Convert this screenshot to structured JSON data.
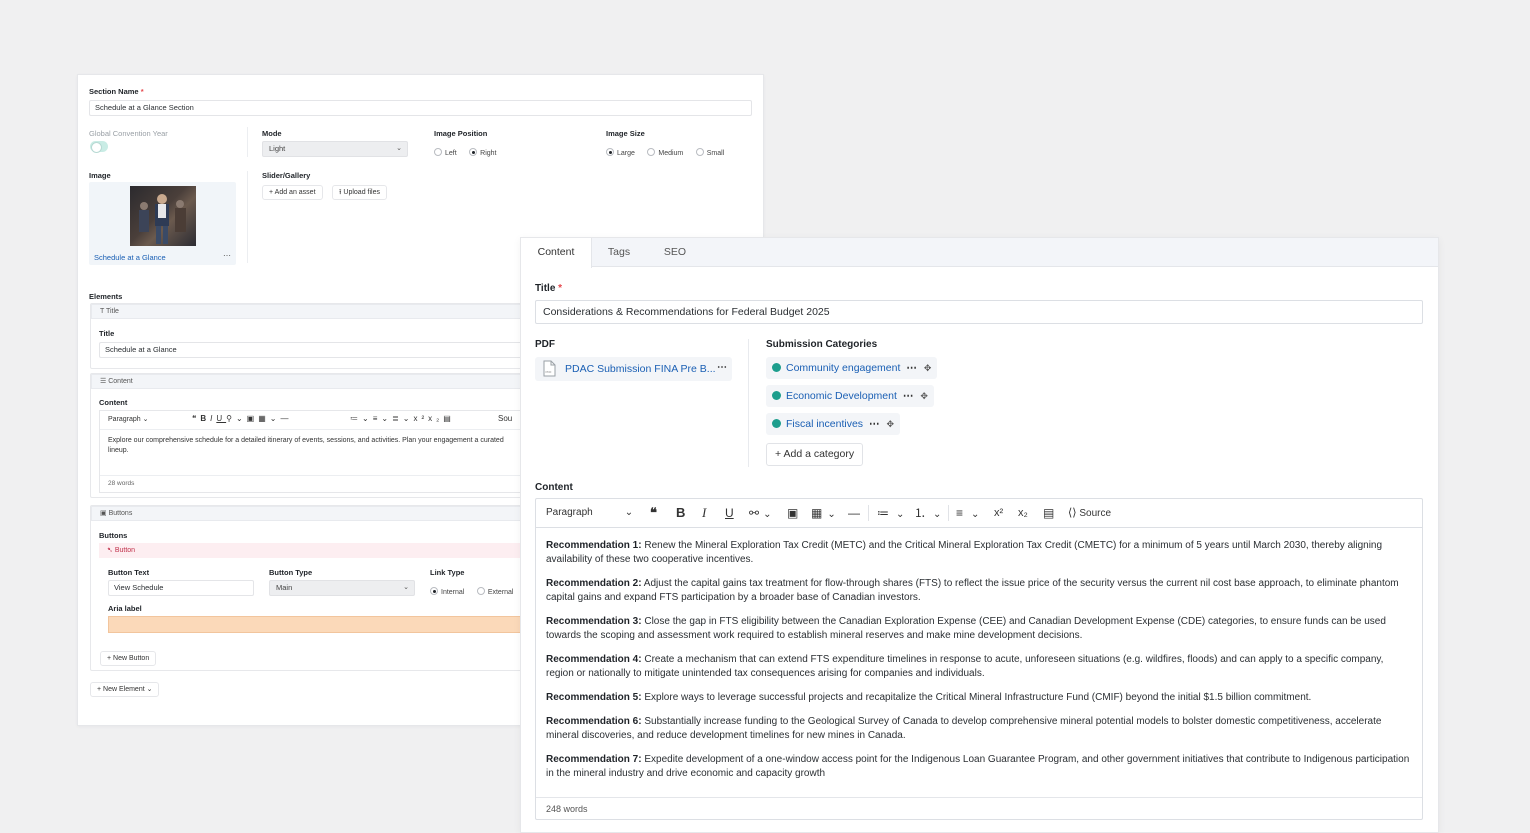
{
  "back": {
    "section_name_label": "Section Name",
    "required_mark": "*",
    "section_name_value": "Schedule at a Glance Section",
    "global_year_label": "Global Convention Year",
    "mode_label": "Mode",
    "mode_value": "Light",
    "image_position_label": "Image Position",
    "image_position_options": [
      "Left",
      "Right"
    ],
    "image_position_selected": "Right",
    "image_size_label": "Image Size",
    "image_size_options": [
      "Large",
      "Medium",
      "Small"
    ],
    "image_size_selected": "Large",
    "image_label": "Image",
    "image_caption": "Schedule at a Glance",
    "image_more": "⋯",
    "slider_label": "Slider/Gallery",
    "add_asset": "+ Add an asset",
    "upload_files": "Upload files",
    "elements_label": "Elements",
    "title_block_label": "Title",
    "title_field_label": "Title",
    "title_value": "Schedule at a Glance",
    "content_block_label": "Content",
    "content_field_label": "Content",
    "toolbar_paragraph": "Paragraph",
    "toolbar_source": "Sou",
    "content_text": "Explore our comprehensive schedule for a detailed itinerary of events, sessions, and activities. Plan your engagement a curated lineup.",
    "content_words": "28 words",
    "buttons_block_label": "Buttons",
    "buttons_field_label": "Buttons",
    "button_item_label": "Button",
    "button_text_label": "Button Text",
    "button_text_value": "View Schedule",
    "button_type_label": "Button Type",
    "button_type_value": "Main",
    "link_type_label": "Link Type",
    "link_type_options": [
      "Internal",
      "External"
    ],
    "link_type_selected": "Internal",
    "aria_label": "Aria label",
    "new_button": "+ New Button",
    "new_element": "+ New Element"
  },
  "front": {
    "tabs": [
      "Content",
      "Tags",
      "SEO"
    ],
    "active_tab": "Content",
    "title_label": "Title",
    "required_mark": "*",
    "title_value": "Considerations & Recommendations for Federal Budget 2025",
    "pdf_label": "PDF",
    "pdf_file": "PDAC Submission FINA Pre B...",
    "pdf_more": "⋯",
    "categories_label": "Submission Categories",
    "categories": [
      {
        "name": "Community engagement",
        "color": "#1d9e8d"
      },
      {
        "name": "Economic Development",
        "color": "#1d9e8d"
      },
      {
        "name": "Fiscal incentives",
        "color": "#1d9e8d"
      }
    ],
    "category_more": "⋯",
    "add_category": "+ Add a category",
    "content_label": "Content",
    "toolbar": {
      "paragraph": "Paragraph",
      "source": "Source"
    },
    "recommendations": [
      {
        "key": "Recommendation 1:",
        "text": " Renew the Mineral Exploration Tax Credit (METC) and the Critical Mineral Exploration Tax Credit (CMETC) for a minimum of 5 years until March 2030, thereby aligning availability of these two cooperative incentives."
      },
      {
        "key": "Recommendation 2:",
        "text": " Adjust the capital gains tax treatment for flow-through shares (FTS) to reflect the issue price of the security versus the current nil cost base approach, to eliminate phantom capital gains and expand FTS participation by a broader base of Canadian investors."
      },
      {
        "key": "Recommendation 3:",
        "text": " Close the gap in FTS eligibility between the Canadian Exploration Expense (CEE) and Canadian Development Expense (CDE) categories, to ensure funds can be used towards the scoping and assessment work required to establish mineral reserves and make mine development decisions."
      },
      {
        "key": "Recommendation 4:",
        "text": " Create a mechanism that can extend FTS expenditure timelines in response to acute, unforeseen situations (e.g. wildfires, floods) and can apply to a specific company, region or nationally to mitigate unintended tax consequences arising for companies and individuals."
      },
      {
        "key": "Recommendation 5:",
        "text": " Explore ways to leverage successful projects and recapitalize the Critical Mineral Infrastructure Fund (CMIF) beyond the initial $1.5 billion commitment."
      },
      {
        "key": "Recommendation 6:",
        "text": " Substantially increase funding to the Geological Survey of Canada to develop comprehensive mineral potential models to bolster domestic competitiveness, accelerate mineral discoveries, and reduce development timelines for new mines in Canada."
      },
      {
        "key": "Recommendation 7:",
        "text": " Expedite development of a one-window access point for the Indigenous Loan Guarantee Program, and other government initiatives that contribute to Indigenous participation in the mineral industry and drive economic and capacity growth"
      }
    ],
    "word_count": "248 words"
  },
  "colors": {
    "accent_green": "#1d9e8d",
    "link_blue": "#1a5fb4",
    "required_red": "#e5484d",
    "aria_fill": "#fbd9b9",
    "button_row_pink": "#fdeef1"
  }
}
